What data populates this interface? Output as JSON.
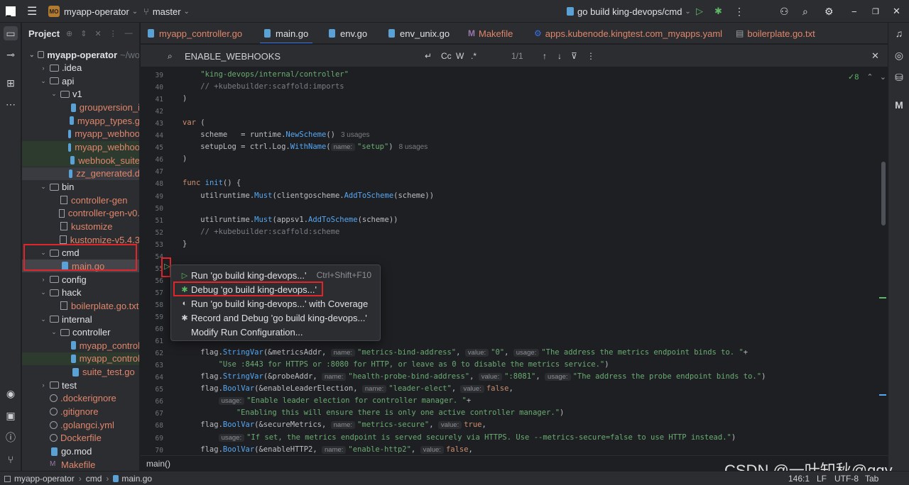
{
  "titlebar": {
    "project_badge": "MO",
    "project_name": "myapp-operator",
    "branch": "master",
    "run_config": "go build king-devops/cmd"
  },
  "project_panel": {
    "title": "Project",
    "tree": [
      {
        "label": "myapp-operator",
        "suffix": "~/wo",
        "level": 0,
        "type": "folder",
        "open": true
      },
      {
        "label": ".idea",
        "level": 1,
        "type": "folder",
        "open": false
      },
      {
        "label": "api",
        "level": 1,
        "type": "folder",
        "open": true
      },
      {
        "label": "v1",
        "level": 2,
        "type": "folder",
        "open": true
      },
      {
        "label": "groupversion_i",
        "level": 3,
        "type": "go"
      },
      {
        "label": "myapp_types.g",
        "level": 3,
        "type": "go"
      },
      {
        "label": "myapp_webhoo",
        "level": 3,
        "type": "go"
      },
      {
        "label": "myapp_webhoo",
        "level": 3,
        "type": "go"
      },
      {
        "label": "webhook_suite",
        "level": 3,
        "type": "go"
      },
      {
        "label": "zz_generated.d",
        "level": 3,
        "type": "go"
      },
      {
        "label": "bin",
        "level": 1,
        "type": "folder",
        "open": true
      },
      {
        "label": "controller-gen",
        "level": 2,
        "type": "bin"
      },
      {
        "label": "controller-gen-v0.",
        "level": 2,
        "type": "bin"
      },
      {
        "label": "kustomize",
        "level": 2,
        "type": "bin"
      },
      {
        "label": "kustomize-v5.4.3",
        "level": 2,
        "type": "bin"
      },
      {
        "label": "cmd",
        "level": 1,
        "type": "folder",
        "open": true
      },
      {
        "label": "main.go",
        "level": 2,
        "type": "go"
      },
      {
        "label": "config",
        "level": 1,
        "type": "folder",
        "open": false
      },
      {
        "label": "hack",
        "level": 1,
        "type": "folder",
        "open": true
      },
      {
        "label": "boilerplate.go.txt",
        "level": 2,
        "type": "txt"
      },
      {
        "label": "internal",
        "level": 1,
        "type": "folder",
        "open": true
      },
      {
        "label": "controller",
        "level": 2,
        "type": "folder",
        "open": true
      },
      {
        "label": "myapp_control",
        "level": 3,
        "type": "go"
      },
      {
        "label": "myapp_control",
        "level": 3,
        "type": "go"
      },
      {
        "label": "suite_test.go",
        "level": 3,
        "type": "go"
      },
      {
        "label": "test",
        "level": 1,
        "type": "folder",
        "open": false
      },
      {
        "label": ".dockerignore",
        "level": 1,
        "type": "dot"
      },
      {
        "label": ".gitignore",
        "level": 1,
        "type": "dot"
      },
      {
        "label": ".golangci.yml",
        "level": 1,
        "type": "dot"
      },
      {
        "label": "Dockerfile",
        "level": 1,
        "type": "dot"
      },
      {
        "label": "go.mod",
        "level": 1,
        "type": "go"
      },
      {
        "label": "Makefile",
        "level": 1,
        "type": "make"
      }
    ]
  },
  "tabs": [
    {
      "label": "myapp_controller.go",
      "icon": "go-file-icon"
    },
    {
      "label": "main.go",
      "icon": "go-file-icon",
      "active": true
    },
    {
      "label": "env.go",
      "icon": "go-file-icon"
    },
    {
      "label": "env_unix.go",
      "icon": "go-file-icon"
    },
    {
      "label": "Makefile",
      "icon": "makefile-icon"
    },
    {
      "label": "apps.kubenode.kingtest.com_myapps.yaml",
      "icon": "yaml-icon"
    },
    {
      "label": "boilerplate.go.txt",
      "icon": "text-file-icon"
    }
  ],
  "search": {
    "query": "ENABLE_WEBHOOKS",
    "match_case": "Cc",
    "words": "W",
    "regex": ".*",
    "results": "1/1"
  },
  "editor": {
    "inspections": "8",
    "lines": [
      {
        "n": "39",
        "html": "    <span class='str'>\"king-devops/internal/controller\"</span>"
      },
      {
        "n": "40",
        "html": "    <span class='cm'>// +kubebuilder:scaffold:imports</span>"
      },
      {
        "n": "41",
        "html": ")"
      },
      {
        "n": "42",
        "html": ""
      },
      {
        "n": "43",
        "html": "<span class='kw'>var</span> ("
      },
      {
        "n": "44",
        "html": "    scheme   = runtime.<span class='fn'>NewScheme</span>()<span class='usages'>3 usages</span>"
      },
      {
        "n": "45",
        "html": "    setupLog = ctrl.Log.<span class='fn'>WithName</span>(<span class='hint'>name:</span><span class='str'>\"setup\"</span>)<span class='usages'>8 usages</span>"
      },
      {
        "n": "46",
        "html": ")"
      },
      {
        "n": "47",
        "html": ""
      },
      {
        "n": "48",
        "html": "<span class='kw'>func</span> <span class='fn'>init</span>() {"
      },
      {
        "n": "49",
        "html": "    utilruntime.<span class='fn'>Must</span>(clientgoscheme.<span class='fn'>AddToScheme</span>(scheme))"
      },
      {
        "n": "50",
        "html": ""
      },
      {
        "n": "51",
        "html": "    utilruntime.<span class='fn'>Must</span>(appsv1.<span class='fn'>AddToScheme</span>(scheme))"
      },
      {
        "n": "52",
        "html": "    <span class='cm'>// +kubebuilder:scaffold:scheme</span>"
      },
      {
        "n": "53",
        "html": "}"
      },
      {
        "n": "54",
        "html": ""
      },
      {
        "n": "55",
        "html": ""
      },
      {
        "n": "56",
        "html": ""
      },
      {
        "n": "57",
        "html": ""
      },
      {
        "n": "58",
        "html": ""
      },
      {
        "n": "59",
        "html": ""
      },
      {
        "n": "60",
        "html": ""
      },
      {
        "n": "61",
        "html": ""
      },
      {
        "n": "62",
        "html": "    flag.<span class='fn'>StringVar</span>(&amp;metricsAddr, <span class='hint'>name:</span><span class='str'>\"metrics-bind-address\"</span>, <span class='hint'>value:</span><span class='str'>\"0\"</span>, <span class='hint'>usage:</span><span class='str'>\"The address the metrics endpoint binds to. \"</span>+"
      },
      {
        "n": "63",
        "html": "        <span class='str'>\"Use :8443 for HTTPS or :8080 for HTTP, or leave as 0 to disable the metrics service.\"</span>)"
      },
      {
        "n": "64",
        "html": "    flag.<span class='fn'>StringVar</span>(&amp;probeAddr, <span class='hint'>name:</span><span class='str'>\"health-probe-bind-address\"</span>, <span class='hint'>value:</span><span class='str'>\":8081\"</span>, <span class='hint'>usage:</span><span class='str'>\"The address the probe endpoint binds to.\"</span>)"
      },
      {
        "n": "65",
        "html": "    flag.<span class='fn'>BoolVar</span>(&amp;enableLeaderElection, <span class='hint'>name:</span><span class='str'>\"leader-elect\"</span>, <span class='hint'>value:</span><span class='kw'>false</span>,"
      },
      {
        "n": "66",
        "html": "        <span class='hint'>usage:</span><span class='str'>\"Enable leader election for controller manager. \"</span>+"
      },
      {
        "n": "67",
        "html": "            <span class='str'>\"Enabling this will ensure there is only one active controller manager.\"</span>)"
      },
      {
        "n": "68",
        "html": "    flag.<span class='fn'>BoolVar</span>(&amp;secureMetrics, <span class='hint'>name:</span><span class='str'>\"metrics-secure\"</span>, <span class='hint'>value:</span><span class='kw'>true</span>,"
      },
      {
        "n": "69",
        "html": "        <span class='hint'>usage:</span><span class='str'>\"If set, the metrics endpoint is served securely via HTTPS. Use --metrics-secure=false to use HTTP instead.\"</span>)"
      },
      {
        "n": "70",
        "html": "    flag.<span class='fn'>BoolVar</span>(&amp;enableHTTP2, <span class='hint'>name:</span><span class='str'>\"enable-http2\"</span>, <span class='hint'>value:</span><span class='kw'>false</span>,"
      }
    ]
  },
  "popup": {
    "items": [
      {
        "label": "Run 'go build king-devops...'",
        "shortcut": "Ctrl+Shift+F10",
        "icon": "run-icon"
      },
      {
        "label": "Debug 'go build king-devops...'",
        "shortcut": "",
        "icon": "debug-icon"
      },
      {
        "label": "Run 'go build king-devops...' with Coverage",
        "shortcut": "",
        "icon": "coverage-icon"
      },
      {
        "label": "Record and Debug 'go build king-devops...'",
        "shortcut": "",
        "icon": "record-debug-icon"
      },
      {
        "label": "Modify Run Configuration...",
        "shortcut": "",
        "icon": ""
      }
    ]
  },
  "editor_breadcrumb": "main()",
  "statusbar": {
    "crumbs": [
      "myapp-operator",
      "cmd",
      "main.go"
    ],
    "position": "146:1",
    "line_sep": "LF",
    "encoding": "UTF-8",
    "indent": "Tab"
  },
  "watermark": "CSDN @一叶知秋@qqy"
}
